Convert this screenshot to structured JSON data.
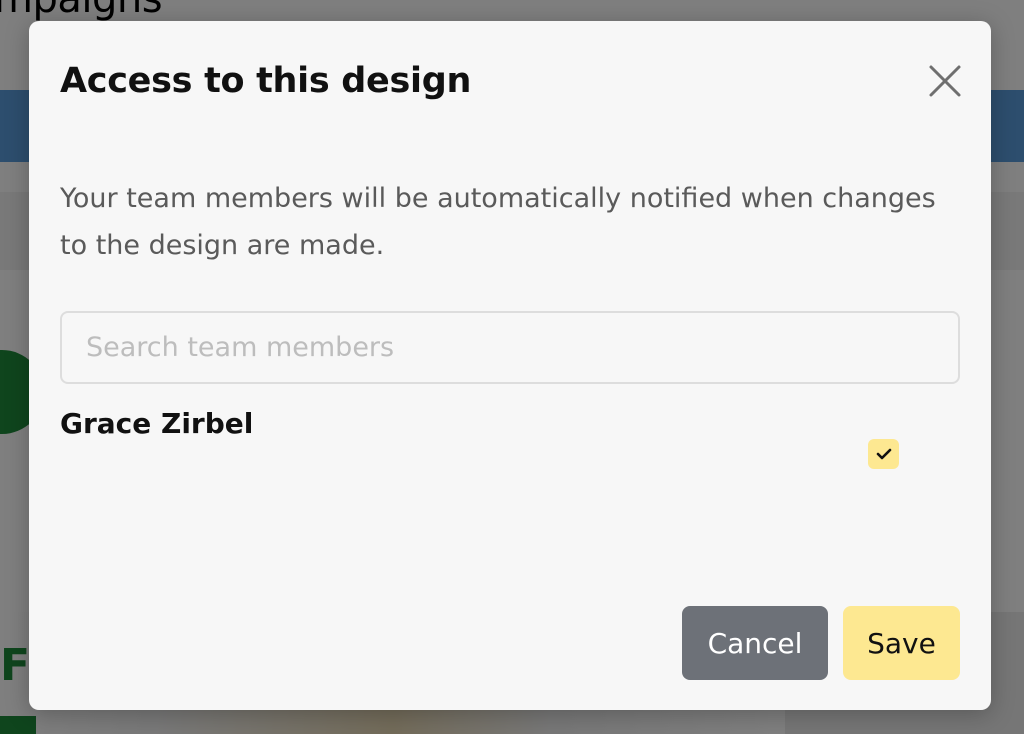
{
  "background": {
    "page_title": "mpaigns"
  },
  "modal": {
    "title": "Access to this design",
    "description": "Your team members will be automatically notified when changes to the design are made.",
    "search": {
      "placeholder": "Search team members",
      "value": ""
    },
    "members": [
      {
        "name": "Grace Zirbel",
        "checked": true
      }
    ],
    "buttons": {
      "cancel_label": "Cancel",
      "save_label": "Save"
    },
    "icons": {
      "close": "close-icon",
      "check": "checkmark-icon"
    }
  },
  "colors": {
    "accent_yellow": "#fde891",
    "cancel_gray": "#6d7178",
    "modal_bg": "#f7f7f7"
  }
}
